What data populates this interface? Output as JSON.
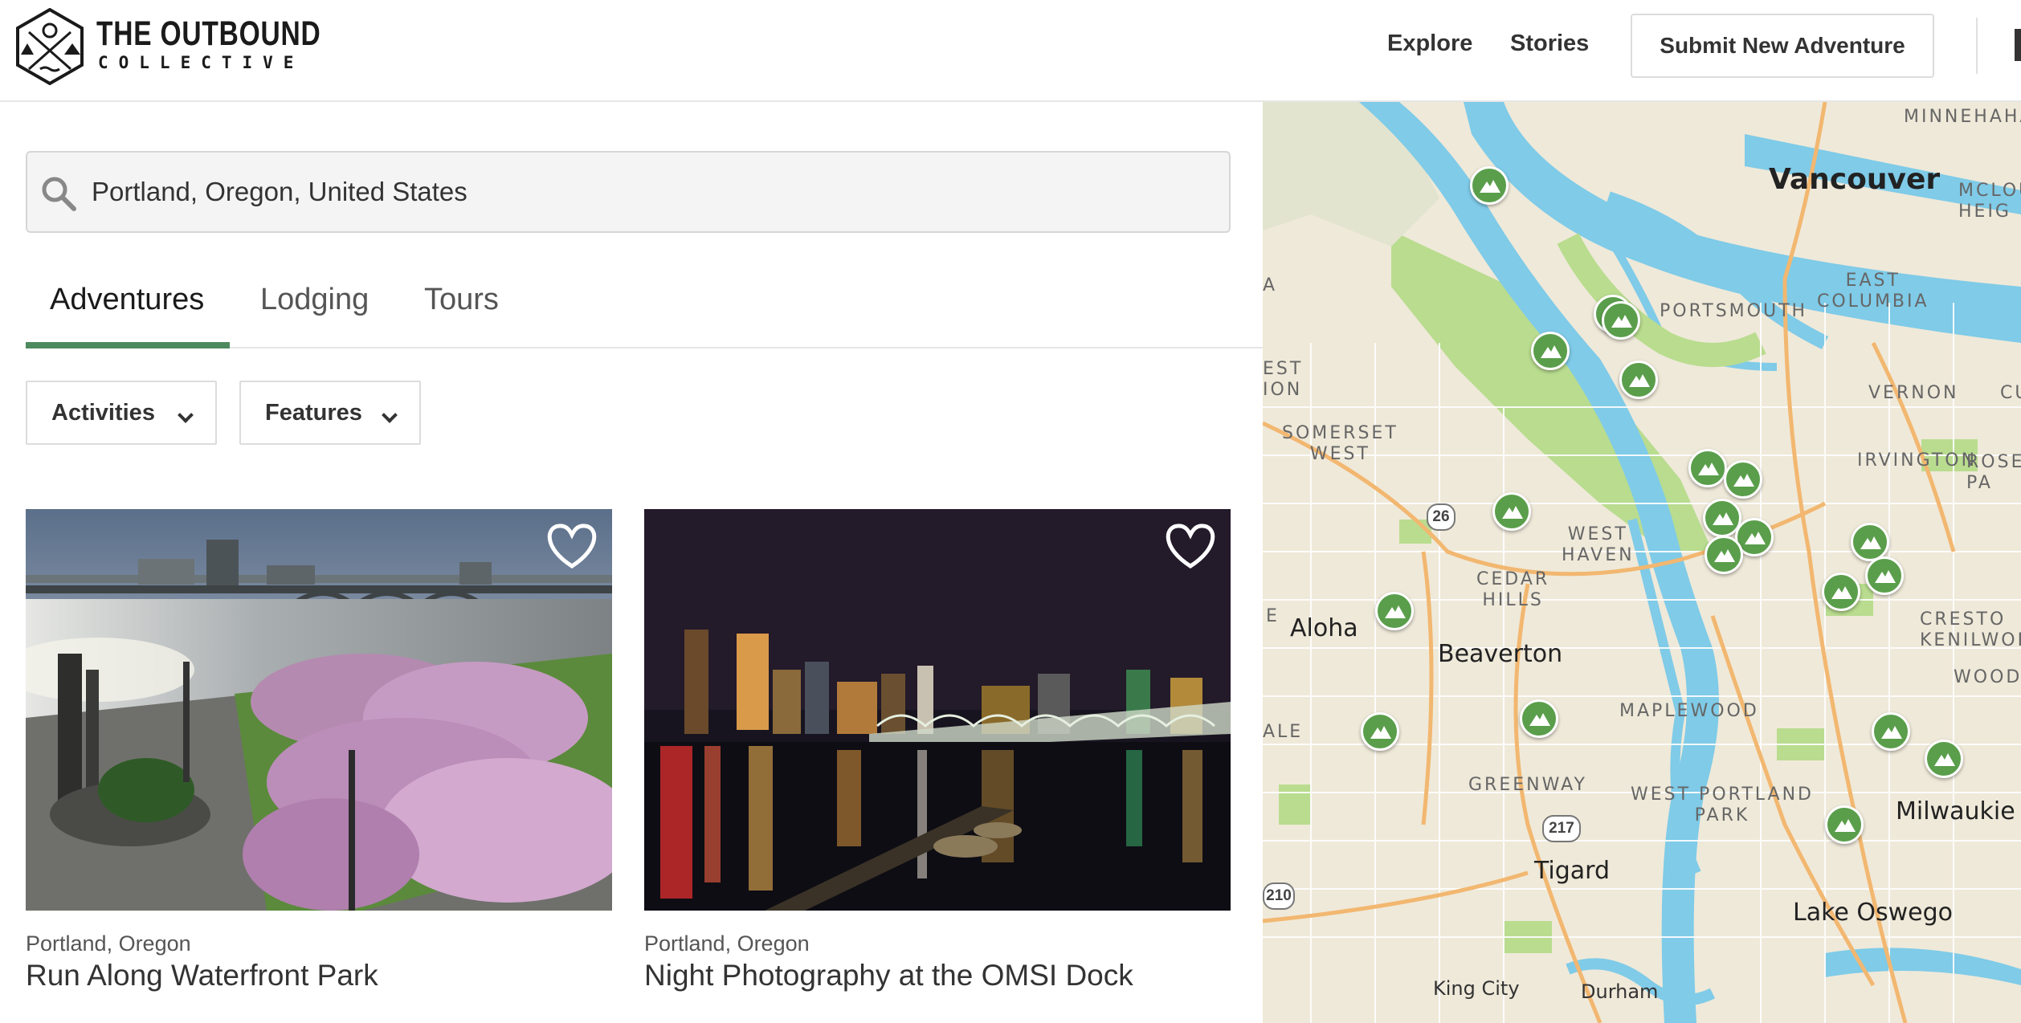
{
  "header": {
    "brand_title": "THE OUTBOUND",
    "brand_subtitle": "COLLECTIVE",
    "nav": {
      "explore": "Explore",
      "stories": "Stories"
    },
    "submit_label": "Submit New Adventure",
    "logo_icon": "compass-mountain-logo"
  },
  "search": {
    "value": "Portland, Oregon, United States",
    "icon": "search-icon"
  },
  "tabs": [
    {
      "label": "Adventures",
      "active": true
    },
    {
      "label": "Lodging",
      "active": false
    },
    {
      "label": "Tours",
      "active": false
    }
  ],
  "filters": [
    {
      "label": "Activities",
      "icon": "chevron-down-icon"
    },
    {
      "label": "Features",
      "icon": "chevron-down-icon"
    }
  ],
  "cards": [
    {
      "location": "Portland, Oregon",
      "title": "Run Along Waterfront Park",
      "favorite": false
    },
    {
      "location": "Portland, Oregon",
      "title": "Night Photography at the OMSI Dock",
      "favorite": false
    }
  ],
  "map": {
    "cities": {
      "vancouver": "Vancouver",
      "aloha": "Aloha",
      "beaverton": "Beaverton",
      "tigard": "Tigard",
      "milwaukie": "Milwaukie",
      "lake_oswego": "Lake Oswego",
      "king_city": "King City",
      "durham": "Durham"
    },
    "neighborhoods": {
      "minnehaha": "MINNEHAHA",
      "mcloughlin_heights": "MCLOU\nHEIG",
      "east_columbia": "EAST\nCOLUMBIA",
      "portsmouth": "PORTSMOUTH",
      "vernon": "VERNON",
      "irvington": "IRVINGTON",
      "rose_city_park": "ROSE\nPA",
      "somerset_west": "SOMERSET\nWEST",
      "west_haven": "WEST\nHAVEN",
      "cedar_hills": "CEDAR\nHILLS",
      "crestwood_kenilworth": "CRESTO\nKENILWOR",
      "woodstock": "WOODS",
      "maplewood": "MAPLEWOOD",
      "greenway": "GREENWAY",
      "west_portland_park": "WEST PORTLAND\nPARK",
      "est_ion": "EST\nION",
      "cu": "CU",
      "ale": "ALE",
      "e": "E",
      "a": "A"
    },
    "shields": {
      "us26": "26",
      "or217": "217",
      "or210": "210"
    },
    "pin_icon": "mountain-icon",
    "colors": {
      "water": "#7fcbe8",
      "park": "#b9dc8f",
      "land": "#efe9d9",
      "pin": "#5a9e4b",
      "accent": "#4e8a5f"
    }
  }
}
